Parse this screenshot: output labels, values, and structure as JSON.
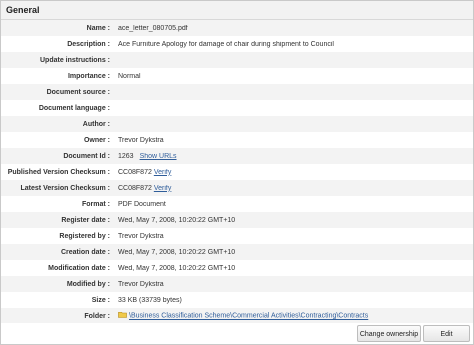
{
  "section": {
    "title": "General"
  },
  "fields": {
    "name": {
      "label": "Name :",
      "value": "ace_letter_080705.pdf"
    },
    "description": {
      "label": "Description :",
      "value": "Ace Furniture Apology for damage of chair during shipment to Council"
    },
    "update_instructions": {
      "label": "Update instructions :",
      "value": ""
    },
    "importance": {
      "label": "Importance :",
      "value": "Normal"
    },
    "document_source": {
      "label": "Document source :",
      "value": ""
    },
    "document_language": {
      "label": "Document language :",
      "value": ""
    },
    "author": {
      "label": "Author :",
      "value": ""
    },
    "owner": {
      "label": "Owner :",
      "value": "Trevor Dykstra"
    },
    "document_id": {
      "label": "Document Id :",
      "value": "1263",
      "link": "Show URLs"
    },
    "published_checksum": {
      "label": "Published Version Checksum :",
      "value": "CC08F872",
      "link": "Verify"
    },
    "latest_checksum": {
      "label": "Latest Version Checksum :",
      "value": "CC08F872",
      "link": "Verify"
    },
    "format": {
      "label": "Format :",
      "value": "PDF Document"
    },
    "register_date": {
      "label": "Register date :",
      "value": "Wed, May 7, 2008, 10:20:22 GMT+10"
    },
    "registered_by": {
      "label": "Registered by :",
      "value": "Trevor Dykstra"
    },
    "creation_date": {
      "label": "Creation date :",
      "value": "Wed, May 7, 2008, 10:20:22 GMT+10"
    },
    "modification_date": {
      "label": "Modification date :",
      "value": "Wed, May 7, 2008, 10:20:22 GMT+10"
    },
    "modified_by": {
      "label": "Modified by :",
      "value": "Trevor Dykstra"
    },
    "size": {
      "label": "Size :",
      "value": "33 KB (33739 bytes)"
    },
    "folder": {
      "label": "Folder :",
      "path": "\\Business Classification Scheme\\Commercial Activities\\Contracting\\Contracts",
      "icon": "folder-icon"
    }
  },
  "buttons": {
    "change_ownership": "Change ownership",
    "edit": "Edit"
  },
  "colors": {
    "link": "#2f5d9a",
    "row_alt": "#f3f3f3",
    "header_bg": "#f2f2f2"
  }
}
